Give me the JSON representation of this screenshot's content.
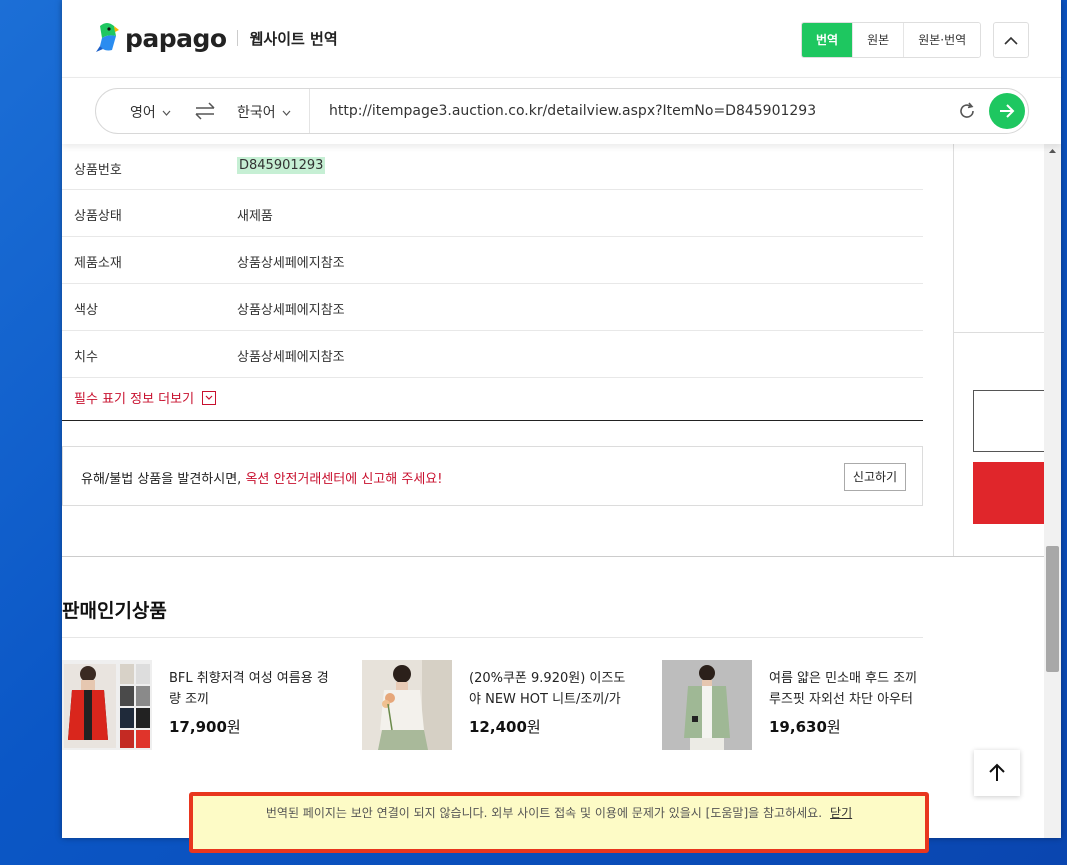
{
  "header": {
    "logo_text": "papago",
    "subtitle": "웹사이트 번역",
    "modes": [
      "번역",
      "원본",
      "원본·번역"
    ]
  },
  "bar": {
    "source_lang": "영어",
    "target_lang": "한국어",
    "url": "http://itempage3.auction.co.kr/detailview.aspx?ItemNo=D845901293"
  },
  "specs": [
    {
      "label": "상품번호",
      "value": "D845901293"
    },
    {
      "label": "상품상태",
      "value": "새제품"
    },
    {
      "label": "제품소재",
      "value": "상품상세페에지참조"
    },
    {
      "label": "색상",
      "value": "상품상세페에지참조"
    },
    {
      "label": "치수",
      "value": "상품상세페에지참조"
    }
  ],
  "more_link": "필수 표기 정보 더보기",
  "report": {
    "text": "유해/불법 상품을 발견하시면, ",
    "highlight": "옥션 안전거래센터에 신고해 주세요!",
    "button": "신고하기"
  },
  "popular": {
    "title": "판매인기상품",
    "products": [
      {
        "name": "BFL 취향저격 여성 여름용 경량 조끼",
        "price": "17,900",
        "unit": "원"
      },
      {
        "name": "(20%쿠폰 9.920원) 이즈도야 NEW HOT 니트/조끼/가",
        "price": "12,400",
        "unit": "원"
      },
      {
        "name": "여름 얇은 민소매 후드 조끼 루즈핏 자외선 차단 아우터",
        "price": "19,630",
        "unit": "원"
      }
    ]
  },
  "notice": {
    "text": "번역된 페이지는 보안 연결이 되지 않습니다. 외부 사이트 접속 및 이용에 문제가 있을시 [도움말]을 참고하세요.",
    "close": "닫기"
  },
  "colors": {
    "accent_green": "#1ec760",
    "red": "#c8102e",
    "notice_border": "#e8361e"
  }
}
